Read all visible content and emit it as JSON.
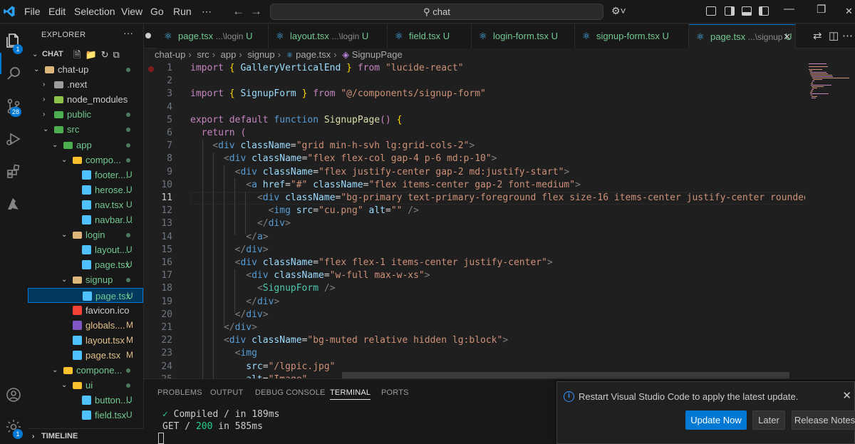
{
  "titlebar": {
    "menus": [
      "File",
      "Edit",
      "Selection",
      "View",
      "Go",
      "Run",
      "⋯"
    ],
    "search_text": "chat"
  },
  "activity": {
    "explorer_badge": "1",
    "scm_badge": "28",
    "settings_badge": "1"
  },
  "explorer": {
    "title": "EXPLORER",
    "more": "···",
    "root": "CHAT",
    "timeline": "TIMELINE",
    "items": [
      {
        "label": "chat-up",
        "status": "dot",
        "git": ""
      },
      {
        "label": ".next",
        "status": "",
        "git": ""
      },
      {
        "label": "node_modules",
        "status": "",
        "git": ""
      },
      {
        "label": "public",
        "status": "dot",
        "git": "u"
      },
      {
        "label": "src",
        "status": "dot",
        "git": "u"
      },
      {
        "label": "app",
        "status": "dot",
        "git": "u"
      },
      {
        "label": "compo...",
        "status": "dot",
        "git": "u"
      },
      {
        "label": "footer....",
        "status": "U",
        "git": "u"
      },
      {
        "label": "herose...",
        "status": "U",
        "git": "u"
      },
      {
        "label": "nav.tsx",
        "status": "U",
        "git": "u"
      },
      {
        "label": "navbar....",
        "status": "U",
        "git": "u"
      },
      {
        "label": "login",
        "status": "dot",
        "git": "u"
      },
      {
        "label": "layout....",
        "status": "U",
        "git": "u"
      },
      {
        "label": "page.tsx",
        "status": "U",
        "git": "u"
      },
      {
        "label": "signup",
        "status": "dot",
        "git": "u"
      },
      {
        "label": "page.tsx",
        "status": "U",
        "git": "u"
      },
      {
        "label": "favicon.ico",
        "status": "",
        "git": ""
      },
      {
        "label": "globals....",
        "status": "M",
        "git": "m"
      },
      {
        "label": "layout.tsx",
        "status": "M",
        "git": "m"
      },
      {
        "label": "page.tsx",
        "status": "M",
        "git": "m"
      },
      {
        "label": "compone...",
        "status": "dot",
        "git": "u"
      },
      {
        "label": "ui",
        "status": "dot",
        "git": "u"
      },
      {
        "label": "button....",
        "status": "U",
        "git": "u"
      },
      {
        "label": "field.tsx",
        "status": "U",
        "git": "u"
      }
    ]
  },
  "tabs": [
    {
      "label": "page.tsx",
      "path": "...\\login",
      "status": "U"
    },
    {
      "label": "layout.tsx",
      "path": "...\\login",
      "status": "U"
    },
    {
      "label": "field.tsx",
      "path": "",
      "status": "U"
    },
    {
      "label": "login-form.tsx",
      "path": "",
      "status": "U"
    },
    {
      "label": "signup-form.tsx",
      "path": "",
      "status": "U"
    },
    {
      "label": "page.tsx",
      "path": "...\\signup",
      "status": "U"
    }
  ],
  "breadcrumb": [
    "chat-up",
    "src",
    "app",
    "signup",
    "page.tsx",
    "SignupPage"
  ],
  "editor": {
    "current_line": 11,
    "lines": [
      "import { GalleryVerticalEnd } from \"lucide-react\"",
      "",
      "import { SignupForm } from \"@/components/signup-form\"",
      "",
      "export default function SignupPage() {",
      "  return (",
      "    <div className=\"grid min-h-svh lg:grid-cols-2\">",
      "      <div className=\"flex flex-col gap-4 p-6 md:p-10\">",
      "        <div className=\"flex justify-center gap-2 md:justify-start\">",
      "          <a href=\"#\" className=\"flex items-center gap-2 font-medium\">",
      "            <div className=\"bg-primary text-primary-foreground flex size-16 items-center justify-center rounded-md\">",
      "              <img src=\"cu.png\" alt=\"\" />",
      "            </div>",
      "          </a>",
      "        </div>",
      "        <div className=\"flex flex-1 items-center justify-center\">",
      "          <div className=\"w-full max-w-xs\">",
      "            <SignupForm />",
      "          </div>",
      "        </div>",
      "      </div>",
      "      <div className=\"bg-muted relative hidden lg:block\">",
      "        <img",
      "          src=\"/lgpic.jpg\"",
      "          alt=\"Image\""
    ]
  },
  "panel": {
    "tabs": [
      "PROBLEMS",
      "OUTPUT",
      "DEBUG CONSOLE",
      "TERMINAL",
      "PORTS"
    ],
    "active_tab": "TERMINAL",
    "terminal_line1_check": "✓",
    "terminal_line1": "Compiled / in 189ms",
    "terminal_line2_prefix": "GET / ",
    "terminal_line2_code": "200",
    "terminal_line2_suffix": " in 585ms"
  },
  "notification": {
    "message": "Restart Visual Studio Code to apply the latest update.",
    "buttons": [
      "Update Now",
      "Later",
      "Release Notes"
    ]
  },
  "colors": {
    "accent": "#0078d4",
    "git_untracked": "#73c991",
    "git_modified": "#e2c08d"
  }
}
